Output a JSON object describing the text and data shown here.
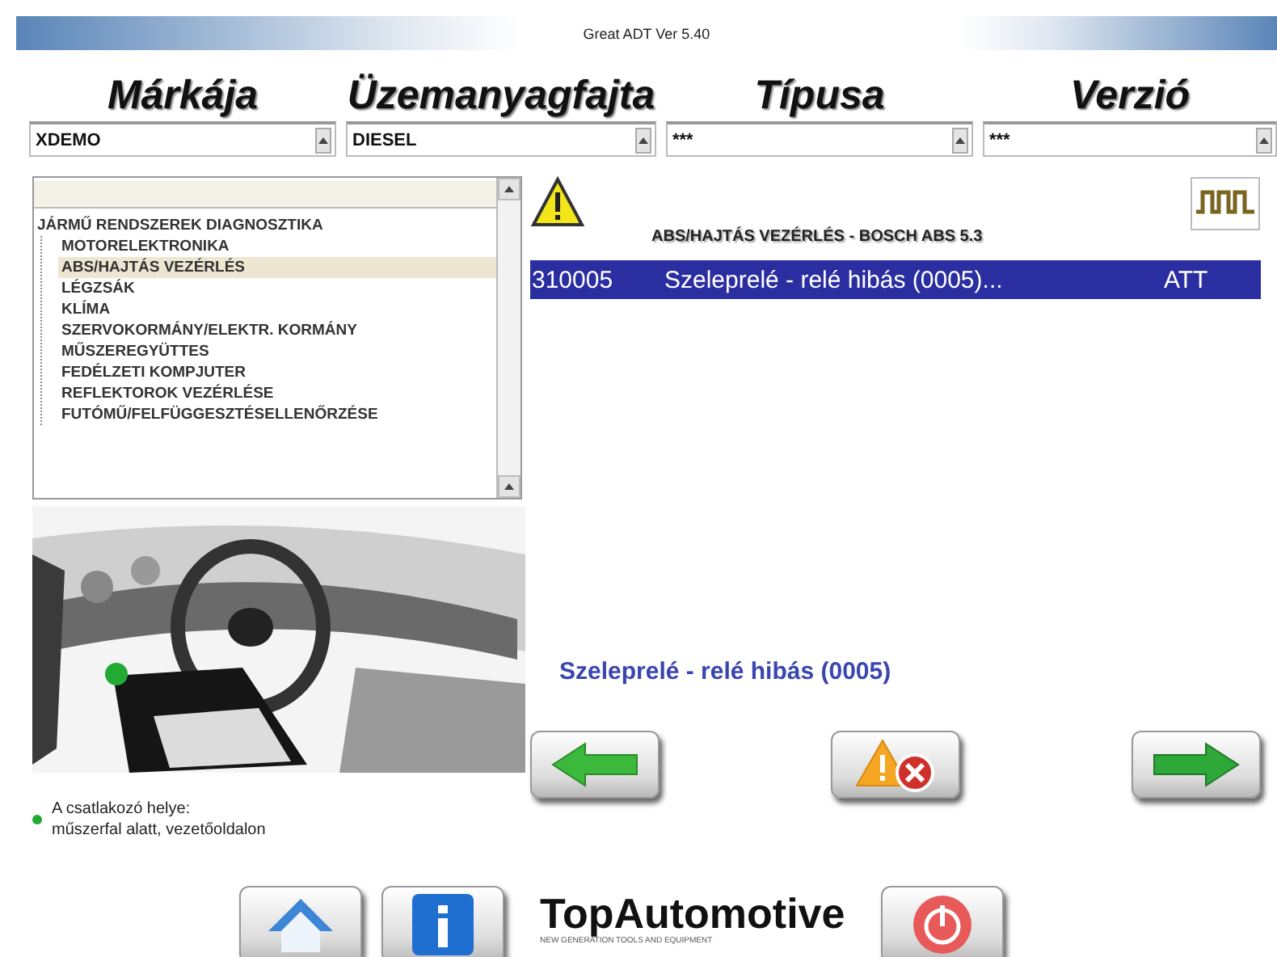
{
  "window": {
    "title": "Great ADT Ver 5.40"
  },
  "selectors": [
    {
      "label": "Márkája",
      "value": "XDEMO"
    },
    {
      "label": "Üzemanyagfajta",
      "value": "DIESEL"
    },
    {
      "label": "Típusa",
      "value": "***"
    },
    {
      "label": "Verzió",
      "value": "***"
    }
  ],
  "tree": {
    "items": [
      {
        "label": "JÁRMŰ RENDSZEREK DIAGNOSZTIKA",
        "selected": false,
        "children": [
          {
            "label": "MOTORELEKTRONIKA",
            "selected": false
          },
          {
            "label": "ABS/HAJTÁS VEZÉRLÉS",
            "selected": true
          },
          {
            "label": "LÉGZSÁK",
            "selected": false
          },
          {
            "label": "KLÍMA",
            "selected": false
          },
          {
            "label": "SZERVOKORMÁNY/ELEKTR. KORMÁNY",
            "selected": false
          },
          {
            "label": "MŰSZEREGYÜTTES",
            "selected": false
          },
          {
            "label": "FEDÉLZETI KOMPJUTER",
            "selected": false
          },
          {
            "label": "REFLEKTOROK VEZÉRLÉSE",
            "selected": false
          },
          {
            "label": "FUTÓMŰ/FELFÜGGESZTÉSELLENŐRZÉSE",
            "selected": false
          }
        ]
      }
    ]
  },
  "connector_note": {
    "lines": [
      "A csatlakozó helye:",
      "műszerfal alatt, vezetőoldalon"
    ]
  },
  "faults": {
    "title": "ABS/HAJTÁS VEZÉRLÉS - BOSCH ABS 5.3",
    "rows": [
      {
        "code": "310005",
        "text": "Szeleprelé - relé hibás (0005)...",
        "status": "ATT",
        "selected": true
      }
    ],
    "detail": "Szeleprelé - relé hibás (0005)"
  },
  "actions": [
    {
      "kind": "back"
    },
    {
      "kind": "clear"
    },
    {
      "kind": "forward"
    }
  ],
  "bottom": [
    {
      "kind": "home"
    },
    {
      "kind": "info"
    },
    {
      "kind": "logo",
      "name": "TopAutomotive",
      "tagline": "NEW GENERATION TOOLS AND EQUIPMENT"
    },
    {
      "kind": "power"
    }
  ]
}
